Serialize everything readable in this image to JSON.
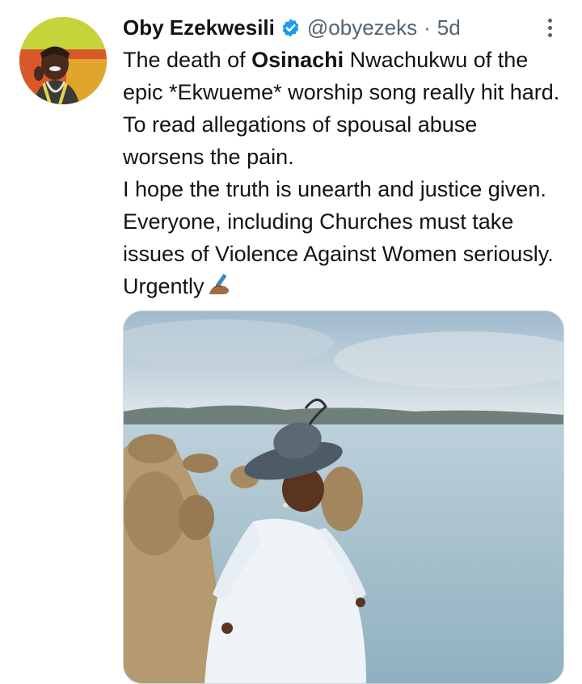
{
  "tweet": {
    "author": {
      "display_name": "Oby Ezekwesili",
      "handle": "@obyezeks",
      "verified": true,
      "avatar_icon": "profile-photo"
    },
    "separator": "·",
    "age": "5d",
    "more_icon": "more-vertical-icon",
    "text": {
      "line1_a": "The death of ",
      "line1_bold": "Osinachi",
      "line1_b": " Nwachukwu of the epic *Ekwueme* worship song really hit hard. To read allegations of spousal abuse worsens the pain.",
      "line2": "I hope the truth is unearth and justice given. Everyone, including Churches must take issues of Violence Against Women seriously. Urgently"
    },
    "emoji": "writing-hand-emoji",
    "media": {
      "type": "photo",
      "description_icon": "tweet-photo"
    }
  },
  "colors": {
    "text": "#0f1419",
    "secondary": "#536471",
    "verified_blue": "#1d9bf0",
    "border": "#cfd9de"
  }
}
